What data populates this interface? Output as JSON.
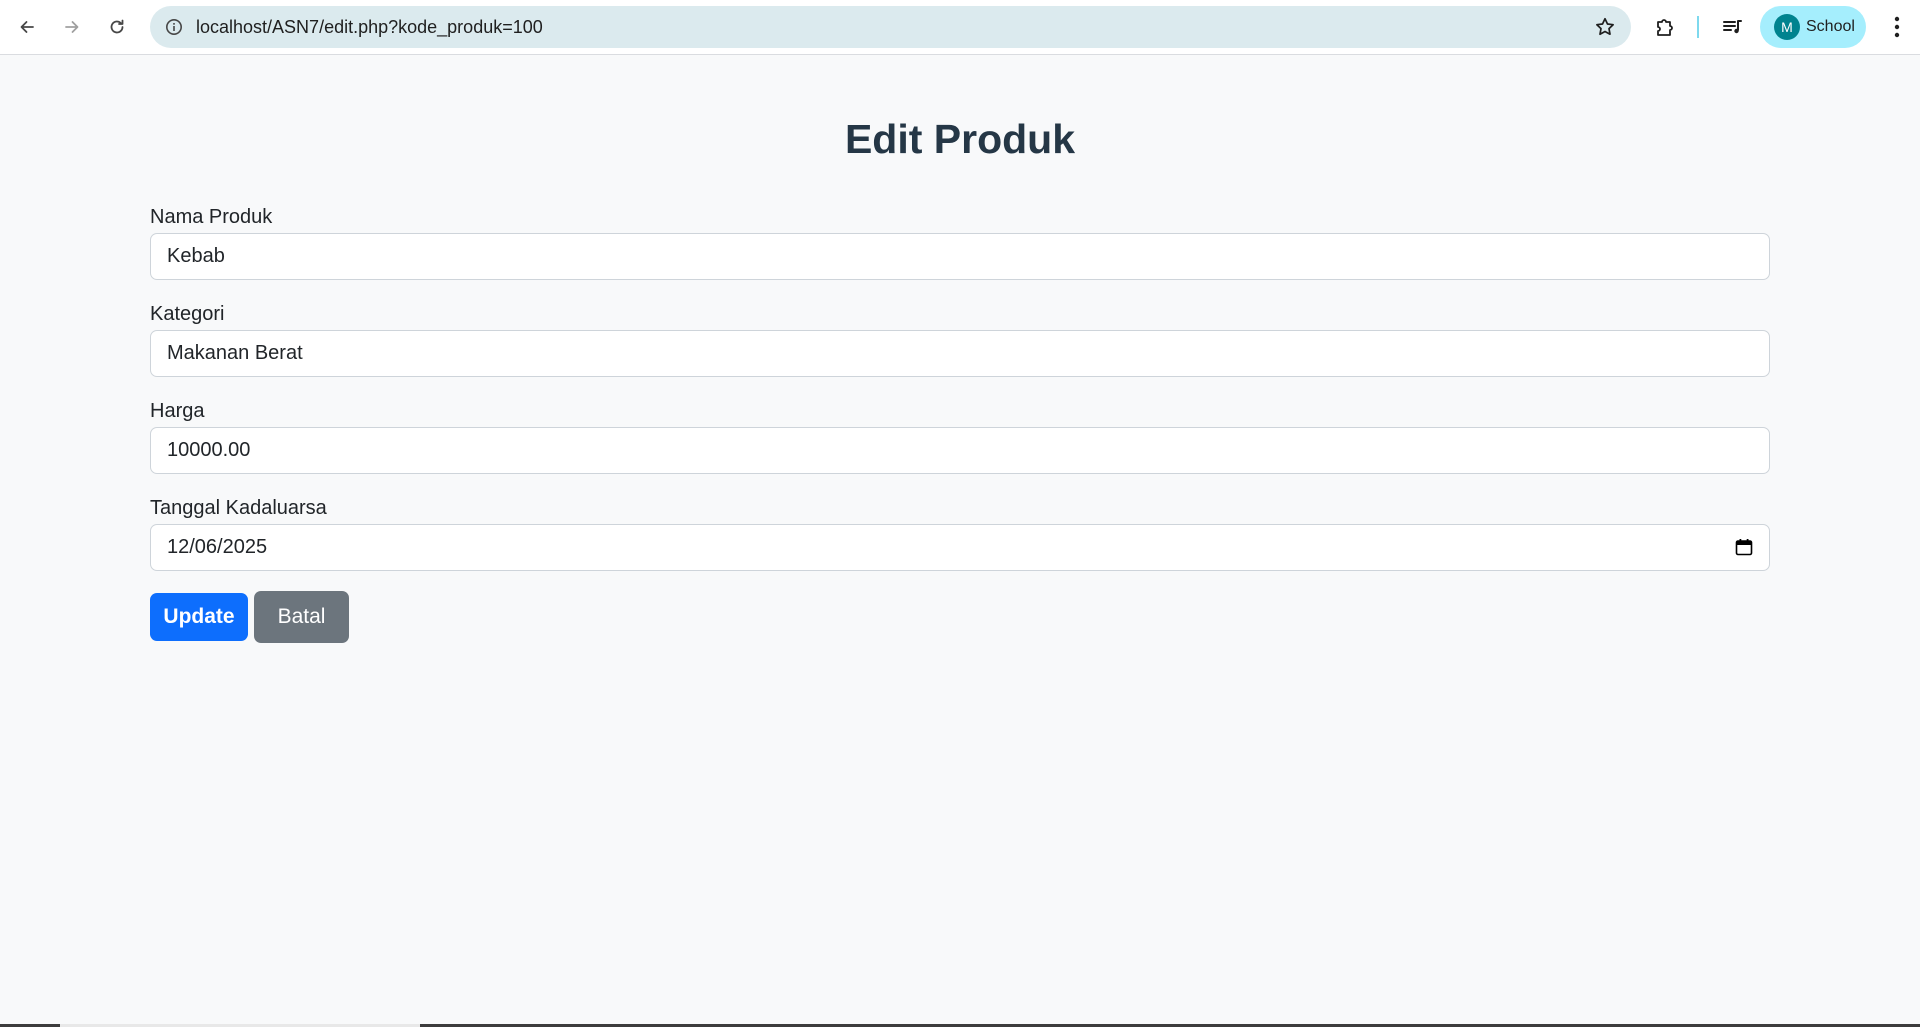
{
  "browser": {
    "url": "localhost/ASN7/edit.php?kode_produk=100",
    "profile": {
      "initial": "M",
      "name": "School"
    },
    "icons": {
      "back": "arrow-left-icon",
      "forward": "arrow-right-icon",
      "reload": "reload-icon",
      "site_info": "info-circle-icon",
      "bookmark": "star-outline-icon",
      "extensions": "puzzle-icon",
      "media": "playlist-icon",
      "menu": "kebab-menu-icon"
    },
    "colors": {
      "omnibox_bg": "#dbeaee",
      "profile_bg": "#a5eefd",
      "avatar_bg": "#00838f"
    }
  },
  "page": {
    "title": "Edit Produk",
    "fields": [
      {
        "label": "Nama Produk",
        "value": "Kebab"
      },
      {
        "label": "Kategori",
        "value": "Makanan Berat"
      },
      {
        "label": "Harga",
        "value": "10000.00"
      },
      {
        "label": "Tanggal Kadaluarsa",
        "value": "12/06/2025",
        "icon": "calendar-icon"
      }
    ],
    "buttons": {
      "update": "Update",
      "cancel": "Batal"
    },
    "colors": {
      "title": "#253746",
      "primary": "#0d6efd",
      "secondary": "#6c757d",
      "background": "#f8f9fa"
    }
  }
}
